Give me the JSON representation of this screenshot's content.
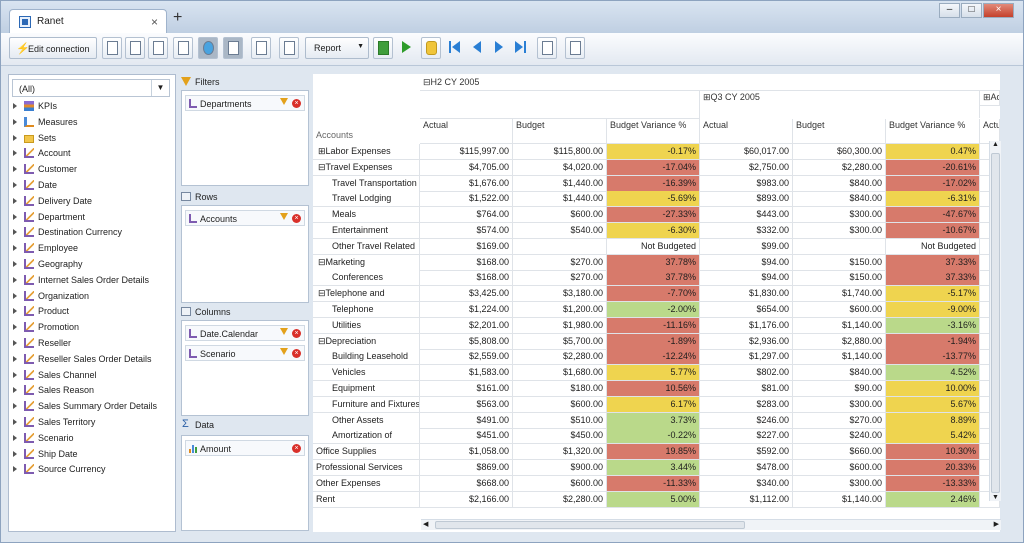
{
  "app": {
    "title": "Ranet",
    "new_tab": "+",
    "close": "×",
    "win_min": "–",
    "win_max": "□",
    "win_close": "×"
  },
  "toolbar": {
    "edit_connection": "Edit connection",
    "report": "Report"
  },
  "left": {
    "combo": "(All)",
    "items": [
      "KPIs",
      "Measures",
      "Sets",
      "Account",
      "Customer",
      "Date",
      "Delivery Date",
      "Department",
      "Destination Currency",
      "Employee",
      "Geography",
      "Internet Sales Order Details",
      "Organization",
      "Product",
      "Promotion",
      "Reseller",
      "Reseller Sales Order Details",
      "Sales Channel",
      "Sales Reason",
      "Sales Summary Order Details",
      "Sales Territory",
      "Scenario",
      "Ship Date",
      "Source Currency"
    ]
  },
  "mid": {
    "filters": "Filters",
    "rows": "Rows",
    "columns": "Columns",
    "data": "Data",
    "filter_fields": [
      "Departments"
    ],
    "row_fields": [
      "Accounts"
    ],
    "column_fields": [
      "Date.Calendar",
      "Scenario"
    ],
    "data_fields": [
      "Amount"
    ]
  },
  "grid": {
    "col_group1": "H2 CY 2005",
    "col_group2": "Q3 CY 2005",
    "col_group3": "Actu",
    "row_header": "Accounts",
    "headers": [
      "Actual",
      "Budget",
      "Budget Variance %",
      "Actual",
      "Budget",
      "Budget Variance %",
      "Actu"
    ],
    "rows": [
      {
        "label": "Labor Expenses",
        "level": 0,
        "exp": "⊞",
        "v": [
          "$115,997.00",
          "$115,800.00",
          "-0.17%",
          "$60,017.00",
          "$60,300.00",
          "0.47%"
        ],
        "c": [
          "",
          "",
          "yellow",
          "",
          "",
          "yellow"
        ]
      },
      {
        "label": "Travel Expenses",
        "level": 0,
        "exp": "⊟",
        "v": [
          "$4,705.00",
          "$4,020.00",
          "-17.04%",
          "$2,750.00",
          "$2,280.00",
          "-20.61%"
        ],
        "c": [
          "",
          "",
          "red",
          "",
          "",
          "red"
        ]
      },
      {
        "label": "Travel Transportation",
        "level": 1,
        "exp": "",
        "v": [
          "$1,676.00",
          "$1,440.00",
          "-16.39%",
          "$983.00",
          "$840.00",
          "-17.02%"
        ],
        "c": [
          "",
          "",
          "red",
          "",
          "",
          "red"
        ]
      },
      {
        "label": "Travel Lodging",
        "level": 1,
        "exp": "",
        "v": [
          "$1,522.00",
          "$1,440.00",
          "-5.69%",
          "$893.00",
          "$840.00",
          "-6.31%"
        ],
        "c": [
          "",
          "",
          "yellow",
          "",
          "",
          "yellow"
        ]
      },
      {
        "label": "Meals",
        "level": 1,
        "exp": "",
        "v": [
          "$764.00",
          "$600.00",
          "-27.33%",
          "$443.00",
          "$300.00",
          "-47.67%"
        ],
        "c": [
          "",
          "",
          "red",
          "",
          "",
          "red"
        ]
      },
      {
        "label": "Entertainment",
        "level": 1,
        "exp": "",
        "v": [
          "$574.00",
          "$540.00",
          "-6.30%",
          "$332.00",
          "$300.00",
          "-10.67%"
        ],
        "c": [
          "",
          "",
          "yellow",
          "",
          "",
          "red"
        ]
      },
      {
        "label": "Other Travel Related",
        "level": 1,
        "exp": "",
        "v": [
          "$169.00",
          "",
          "Not Budgeted",
          "$99.00",
          "",
          "Not Budgeted"
        ],
        "c": [
          "",
          "",
          "",
          "",
          "",
          ""
        ]
      },
      {
        "label": "Marketing",
        "level": 0,
        "exp": "⊟",
        "v": [
          "$168.00",
          "$270.00",
          "37.78%",
          "$94.00",
          "$150.00",
          "37.33%"
        ],
        "c": [
          "",
          "",
          "red",
          "",
          "",
          "red"
        ]
      },
      {
        "label": "Conferences",
        "level": 1,
        "exp": "",
        "v": [
          "$168.00",
          "$270.00",
          "37.78%",
          "$94.00",
          "$150.00",
          "37.33%"
        ],
        "c": [
          "",
          "",
          "red",
          "",
          "",
          "red"
        ]
      },
      {
        "label": "Telephone and",
        "level": 0,
        "exp": "⊟",
        "v": [
          "$3,425.00",
          "$3,180.00",
          "-7.70%",
          "$1,830.00",
          "$1,740.00",
          "-5.17%"
        ],
        "c": [
          "",
          "",
          "red",
          "",
          "",
          "yellow"
        ]
      },
      {
        "label": "Telephone",
        "level": 1,
        "exp": "",
        "v": [
          "$1,224.00",
          "$1,200.00",
          "-2.00%",
          "$654.00",
          "$600.00",
          "-9.00%"
        ],
        "c": [
          "",
          "",
          "green",
          "",
          "",
          "yellow"
        ]
      },
      {
        "label": "Utilities",
        "level": 1,
        "exp": "",
        "v": [
          "$2,201.00",
          "$1,980.00",
          "-11.16%",
          "$1,176.00",
          "$1,140.00",
          "-3.16%"
        ],
        "c": [
          "",
          "",
          "red",
          "",
          "",
          "green"
        ]
      },
      {
        "label": "Depreciation",
        "level": 0,
        "exp": "⊟",
        "v": [
          "$5,808.00",
          "$5,700.00",
          "-1.89%",
          "$2,936.00",
          "$2,880.00",
          "-1.94%"
        ],
        "c": [
          "",
          "",
          "red",
          "",
          "",
          "red"
        ]
      },
      {
        "label": "Building Leasehold",
        "level": 1,
        "exp": "",
        "v": [
          "$2,559.00",
          "$2,280.00",
          "-12.24%",
          "$1,297.00",
          "$1,140.00",
          "-13.77%"
        ],
        "c": [
          "",
          "",
          "red",
          "",
          "",
          "red"
        ]
      },
      {
        "label": "Vehicles",
        "level": 1,
        "exp": "",
        "v": [
          "$1,583.00",
          "$1,680.00",
          "5.77%",
          "$802.00",
          "$840.00",
          "4.52%"
        ],
        "c": [
          "",
          "",
          "yellow",
          "",
          "",
          "green"
        ]
      },
      {
        "label": "Equipment",
        "level": 1,
        "exp": "",
        "v": [
          "$161.00",
          "$180.00",
          "10.56%",
          "$81.00",
          "$90.00",
          "10.00%"
        ],
        "c": [
          "",
          "",
          "red",
          "",
          "",
          "yellow"
        ]
      },
      {
        "label": "Furniture and Fixtures",
        "level": 1,
        "exp": "",
        "v": [
          "$563.00",
          "$600.00",
          "6.17%",
          "$283.00",
          "$300.00",
          "5.67%"
        ],
        "c": [
          "",
          "",
          "yellow",
          "",
          "",
          "yellow"
        ]
      },
      {
        "label": "Other Assets",
        "level": 1,
        "exp": "",
        "v": [
          "$491.00",
          "$510.00",
          "3.73%",
          "$246.00",
          "$270.00",
          "8.89%"
        ],
        "c": [
          "",
          "",
          "green",
          "",
          "",
          "yellow"
        ]
      },
      {
        "label": "Amortization of",
        "level": 1,
        "exp": "",
        "v": [
          "$451.00",
          "$450.00",
          "-0.22%",
          "$227.00",
          "$240.00",
          "5.42%"
        ],
        "c": [
          "",
          "",
          "green",
          "",
          "",
          "yellow"
        ]
      },
      {
        "label": "Office Supplies",
        "level": -1,
        "exp": "",
        "v": [
          "$1,058.00",
          "$1,320.00",
          "19.85%",
          "$592.00",
          "$660.00",
          "10.30%"
        ],
        "c": [
          "",
          "",
          "red",
          "",
          "",
          "red"
        ]
      },
      {
        "label": "Professional Services",
        "level": -1,
        "exp": "",
        "v": [
          "$869.00",
          "$900.00",
          "3.44%",
          "$478.00",
          "$600.00",
          "20.33%"
        ],
        "c": [
          "",
          "",
          "green",
          "",
          "",
          "red"
        ]
      },
      {
        "label": "Other Expenses",
        "level": -1,
        "exp": "",
        "v": [
          "$668.00",
          "$600.00",
          "-11.33%",
          "$340.00",
          "$300.00",
          "-13.33%"
        ],
        "c": [
          "",
          "",
          "red",
          "",
          "",
          "red"
        ]
      },
      {
        "label": "Rent",
        "level": -1,
        "exp": "",
        "v": [
          "$2,166.00",
          "$2,280.00",
          "5.00%",
          "$1,112.00",
          "$1,140.00",
          "2.46%"
        ],
        "c": [
          "",
          "",
          "green",
          "",
          "",
          "green"
        ]
      }
    ]
  },
  "colors": {
    "red": "#d77a6b",
    "yellow": "#efd44f",
    "green": "#bad98a",
    "accent": "#2c68b5"
  },
  "icons": {
    "tab": "ranet-logo-icon",
    "filter": "funnel-icon",
    "remove": "remove-icon",
    "expand": "expand-icon",
    "collapse": "collapse-icon",
    "dimension": "hierarchy-icon",
    "measure": "bar-chart-icon",
    "kpi": "kpi-icon",
    "set": "folder-icon"
  }
}
